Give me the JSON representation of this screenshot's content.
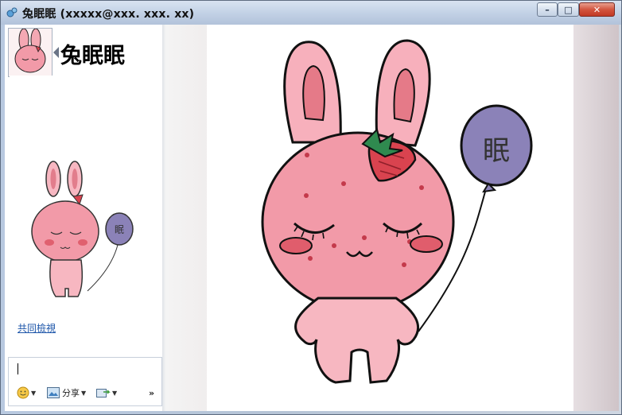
{
  "window": {
    "title": "兔眠眠 (xxxxx@xxx. xxx. xx)",
    "controls": {
      "minimize": "–",
      "maximize": "□",
      "close": "✕"
    }
  },
  "contact": {
    "name": "兔眠眠"
  },
  "sidebar": {
    "shared_view_link": "共同檢視"
  },
  "input_toolbar": {
    "emoticon_icon": "smiley-icon",
    "share_label": "分享",
    "more_label": "»"
  },
  "illustration": {
    "balloon_text": "眠"
  },
  "colors": {
    "title_bar": "#c3d2e6",
    "close_button": "#d2553f",
    "link": "#1c55a9",
    "rabbit_pink": "#f4a8b3",
    "balloon_purple": "#8b82b8"
  }
}
